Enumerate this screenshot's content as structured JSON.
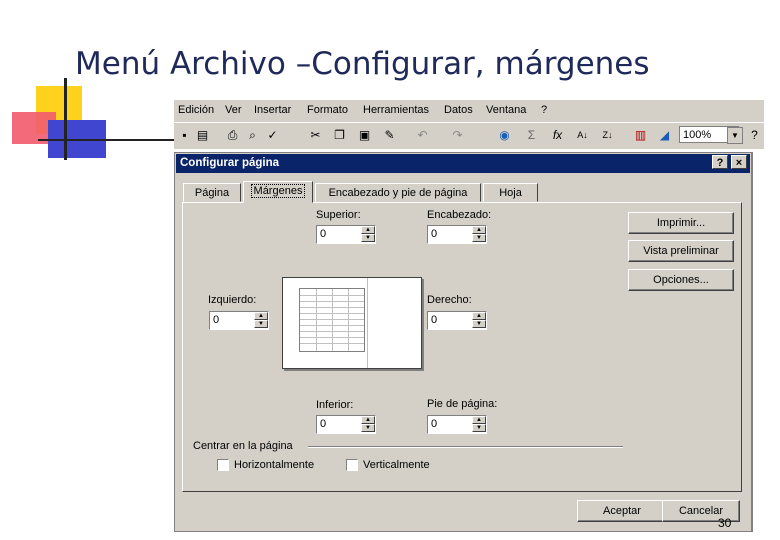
{
  "slide": {
    "title": "Menú Archivo –Configurar, márgenes",
    "page_number": "30"
  },
  "menubar": {
    "items": [
      "Edición",
      "Ver",
      "Insertar",
      "Formato",
      "Herramientas",
      "Datos",
      "Ventana",
      "?"
    ]
  },
  "toolbar": {
    "zoom": "100%",
    "icons": [
      "save-icon",
      "print-preview-icon",
      "print-icon",
      "preview-icon",
      "spellcheck-icon",
      "cut-icon",
      "copy-icon",
      "paste-icon",
      "format-painter-icon",
      "undo-icon",
      "redo-icon",
      "hyperlink-icon",
      "autosum-icon",
      "function-icon",
      "sort-asc-icon",
      "sort-desc-icon",
      "chart-wizard-icon",
      "drawing-icon"
    ]
  },
  "dialog": {
    "title": "Configurar página",
    "help_label": "?",
    "close_label": "×",
    "tabs": [
      "Página",
      "Márgenes",
      "Encabezado y pie de página",
      "Hoja"
    ],
    "active_tab": "Márgenes",
    "fields": {
      "superior": {
        "label": "Superior:",
        "value": "0"
      },
      "encabezado": {
        "label": "Encabezado:",
        "value": "0"
      },
      "izquierdo": {
        "label": "Izquierdo:",
        "value": "0"
      },
      "derecho": {
        "label": "Derecho:",
        "value": "0"
      },
      "inferior": {
        "label": "Inferior:",
        "value": "0"
      },
      "pie": {
        "label": "Pie de página:",
        "value": "0"
      }
    },
    "center_group": {
      "label": "Centrar en la página",
      "horizontal": {
        "label": "Horizontalmente",
        "checked": false
      },
      "vertical": {
        "label": "Verticalmente",
        "checked": false
      }
    },
    "buttons": {
      "imprimir": "Imprimir...",
      "vista": "Vista preliminar",
      "opciones": "Opciones...",
      "aceptar": "Aceptar",
      "cancelar": "Cancelar"
    }
  },
  "colors": {
    "title_text": "#1f2a5a",
    "dialog_titlebar": "#0a246a",
    "face": "#d4d0c8",
    "deco_yellow": "#ffd21e",
    "deco_red": "#f25b6b",
    "deco_blue": "#4146d0"
  }
}
